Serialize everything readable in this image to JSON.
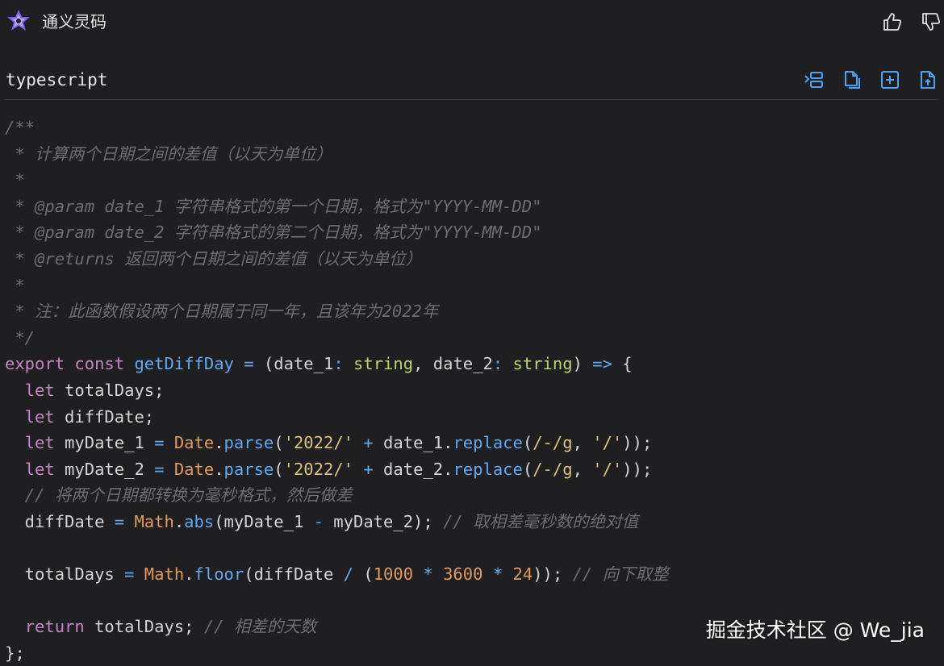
{
  "header": {
    "title": "通义灵码",
    "like_icon": "thumbs-up-icon",
    "dislike_icon": "thumbs-down-icon"
  },
  "code_block": {
    "language": "typescript",
    "toolbar_icons": [
      "insert-at-cursor-icon",
      "copy-icon",
      "new-file-icon",
      "save-file-icon"
    ],
    "lines": [
      [
        [
          "c",
          "/**"
        ]
      ],
      [
        [
          "c",
          " * 计算两个日期之间的差值（以天为单位）"
        ]
      ],
      [
        [
          "c",
          " *"
        ]
      ],
      [
        [
          "c",
          " * @param date_1 字符串格式的第一个日期，格式为\"YYYY-MM-DD\""
        ]
      ],
      [
        [
          "c",
          " * @param date_2 字符串格式的第二个日期，格式为\"YYYY-MM-DD\""
        ]
      ],
      [
        [
          "c",
          " * @returns 返回两个日期之间的差值（以天为单位）"
        ]
      ],
      [
        [
          "c",
          " *"
        ]
      ],
      [
        [
          "c",
          " * 注：此函数假设两个日期属于同一年，且该年为2022年"
        ]
      ],
      [
        [
          "c",
          " */"
        ]
      ],
      [
        [
          "k",
          "export"
        ],
        [
          "p",
          " "
        ],
        [
          "k",
          "const"
        ],
        [
          "p",
          " "
        ],
        [
          "f",
          "getDiffDay"
        ],
        [
          "p",
          " "
        ],
        [
          "op",
          "="
        ],
        [
          "p",
          " (date_1"
        ],
        [
          "op",
          ":"
        ],
        [
          "p",
          " "
        ],
        [
          "t",
          "string"
        ],
        [
          "p",
          ", date_2"
        ],
        [
          "op",
          ":"
        ],
        [
          "p",
          " "
        ],
        [
          "t",
          "string"
        ],
        [
          "p",
          ") "
        ],
        [
          "op",
          "=>"
        ],
        [
          "p",
          " {"
        ]
      ],
      [
        [
          "p",
          "  "
        ],
        [
          "k",
          "let"
        ],
        [
          "p",
          " totalDays;"
        ]
      ],
      [
        [
          "p",
          "  "
        ],
        [
          "k",
          "let"
        ],
        [
          "p",
          " diffDate;"
        ]
      ],
      [
        [
          "p",
          "  "
        ],
        [
          "k",
          "let"
        ],
        [
          "p",
          " myDate_1 "
        ],
        [
          "op",
          "="
        ],
        [
          "p",
          " "
        ],
        [
          "o",
          "Date"
        ],
        [
          "p",
          "."
        ],
        [
          "f",
          "parse"
        ],
        [
          "p",
          "("
        ],
        [
          "s",
          "'2022/'"
        ],
        [
          "p",
          " "
        ],
        [
          "op",
          "+"
        ],
        [
          "p",
          " date_1."
        ],
        [
          "f",
          "replace"
        ],
        [
          "p",
          "("
        ],
        [
          "s",
          "/-/g"
        ],
        [
          "p",
          ", "
        ],
        [
          "s",
          "'/'"
        ],
        [
          "p",
          "));"
        ]
      ],
      [
        [
          "p",
          "  "
        ],
        [
          "k",
          "let"
        ],
        [
          "p",
          " myDate_2 "
        ],
        [
          "op",
          "="
        ],
        [
          "p",
          " "
        ],
        [
          "o",
          "Date"
        ],
        [
          "p",
          "."
        ],
        [
          "f",
          "parse"
        ],
        [
          "p",
          "("
        ],
        [
          "s",
          "'2022/'"
        ],
        [
          "p",
          " "
        ],
        [
          "op",
          "+"
        ],
        [
          "p",
          " date_2."
        ],
        [
          "f",
          "replace"
        ],
        [
          "p",
          "("
        ],
        [
          "s",
          "/-/g"
        ],
        [
          "p",
          ", "
        ],
        [
          "s",
          "'/'"
        ],
        [
          "p",
          "));"
        ]
      ],
      [
        [
          "c",
          "  // 将两个日期都转换为毫秒格式，然后做差"
        ]
      ],
      [
        [
          "p",
          "  diffDate "
        ],
        [
          "op",
          "="
        ],
        [
          "p",
          " "
        ],
        [
          "o",
          "Math"
        ],
        [
          "p",
          "."
        ],
        [
          "f",
          "abs"
        ],
        [
          "p",
          "(myDate_1 "
        ],
        [
          "op",
          "-"
        ],
        [
          "p",
          " myDate_2); "
        ],
        [
          "c",
          "// 取相差毫秒数的绝对值"
        ]
      ],
      [
        [
          "p",
          ""
        ]
      ],
      [
        [
          "p",
          "  totalDays "
        ],
        [
          "op",
          "="
        ],
        [
          "p",
          " "
        ],
        [
          "o",
          "Math"
        ],
        [
          "p",
          "."
        ],
        [
          "f",
          "floor"
        ],
        [
          "p",
          "(diffDate "
        ],
        [
          "op",
          "/"
        ],
        [
          "p",
          " ("
        ],
        [
          "n",
          "1000"
        ],
        [
          "p",
          " "
        ],
        [
          "op",
          "*"
        ],
        [
          "p",
          " "
        ],
        [
          "n",
          "3600"
        ],
        [
          "p",
          " "
        ],
        [
          "op",
          "*"
        ],
        [
          "p",
          " "
        ],
        [
          "n",
          "24"
        ],
        [
          "p",
          ")); "
        ],
        [
          "c",
          "// 向下取整"
        ]
      ],
      [
        [
          "p",
          ""
        ]
      ],
      [
        [
          "p",
          "  "
        ],
        [
          "k",
          "return"
        ],
        [
          "p",
          " totalDays; "
        ],
        [
          "c",
          "// 相差的天数"
        ]
      ],
      [
        [
          "p",
          "};"
        ]
      ]
    ]
  },
  "watermark": "掘金技术社区 @ We_jia"
}
